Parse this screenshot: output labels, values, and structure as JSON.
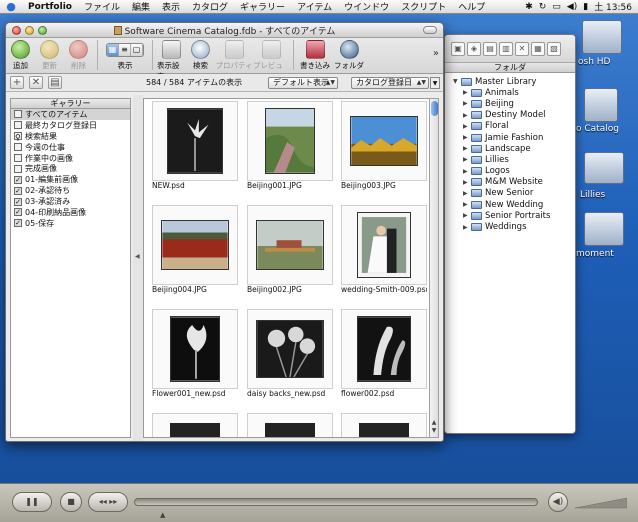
{
  "menubar": {
    "app": "Portfolio",
    "items": [
      "ファイル",
      "編集",
      "表示",
      "カタログ",
      "ギャラリー",
      "アイテム",
      "ウインドウ",
      "スクリプト",
      "ヘルプ"
    ],
    "clock": "土 13:56"
  },
  "desktop": {
    "labels": [
      "osh HD",
      "o Catalog",
      "Lillies",
      "moment"
    ]
  },
  "window": {
    "title": "Software Cinema Catalog.fdb - すべてのアイテム"
  },
  "toolbar": {
    "add": "追加",
    "update": "更新",
    "delete": "削除",
    "view": "表示",
    "view_settings": "表示設定",
    "search": "検索",
    "properties": "プロパティ",
    "preview": "プレビュー",
    "write": "書き込み",
    "folder": "フォルダ",
    "overflow": "»"
  },
  "subbar": {
    "count": "584 / 584 アイテムの表示",
    "display_mode": "デフォルト表示",
    "sort_by": "カタログ登録日"
  },
  "galleries": {
    "header": "ギャラリー",
    "items": [
      {
        "label": "すべてのアイテム",
        "icon": "gallery-icon"
      },
      {
        "label": "最終カタログ登録日",
        "icon": "gallery-icon"
      },
      {
        "label": "検索結果",
        "icon": "search-icon"
      },
      {
        "label": "今週の仕事",
        "icon": "gallery-icon"
      },
      {
        "label": "作業中の画像",
        "icon": "gallery-icon"
      },
      {
        "label": "完成画像",
        "icon": "gallery-icon"
      },
      {
        "label": "01-編集前画像",
        "icon": "check-icon"
      },
      {
        "label": "02-承認待ち",
        "icon": "check-icon"
      },
      {
        "label": "03-承認済み",
        "icon": "check-icon"
      },
      {
        "label": "04-印刷納品画像",
        "icon": "check-icon"
      },
      {
        "label": "05-保存",
        "icon": "check-icon"
      }
    ]
  },
  "thumbnails": [
    {
      "name": "NEW.psd",
      "kind": "flower-bw"
    },
    {
      "name": "Beijing001.JPG",
      "kind": "great-wall"
    },
    {
      "name": "Beijing003.JPG",
      "kind": "roof"
    },
    {
      "name": "Beijing004.JPG",
      "kind": "red-wall"
    },
    {
      "name": "Beijing002.JPG",
      "kind": "city"
    },
    {
      "name": "wedding-Smith-009.psd",
      "kind": "wedding"
    },
    {
      "name": "Flower001_new.psd",
      "kind": "calla-bw"
    },
    {
      "name": "daisy backs_new.psd",
      "kind": "daisy-bw"
    },
    {
      "name": "flower002.psd",
      "kind": "calla2-bw"
    }
  ],
  "folders": {
    "header": "フォルダ",
    "root": "Master Library",
    "children": [
      "Animals",
      "Beijing",
      "Destiny Model",
      "Floral",
      "Jamie Fashion",
      "Landscape",
      "Lillies",
      "Logos",
      "M&M Website",
      "New Senior",
      "New Wedding",
      "Senior Portraits",
      "Weddings"
    ]
  },
  "player": {
    "progress": 0.0
  }
}
